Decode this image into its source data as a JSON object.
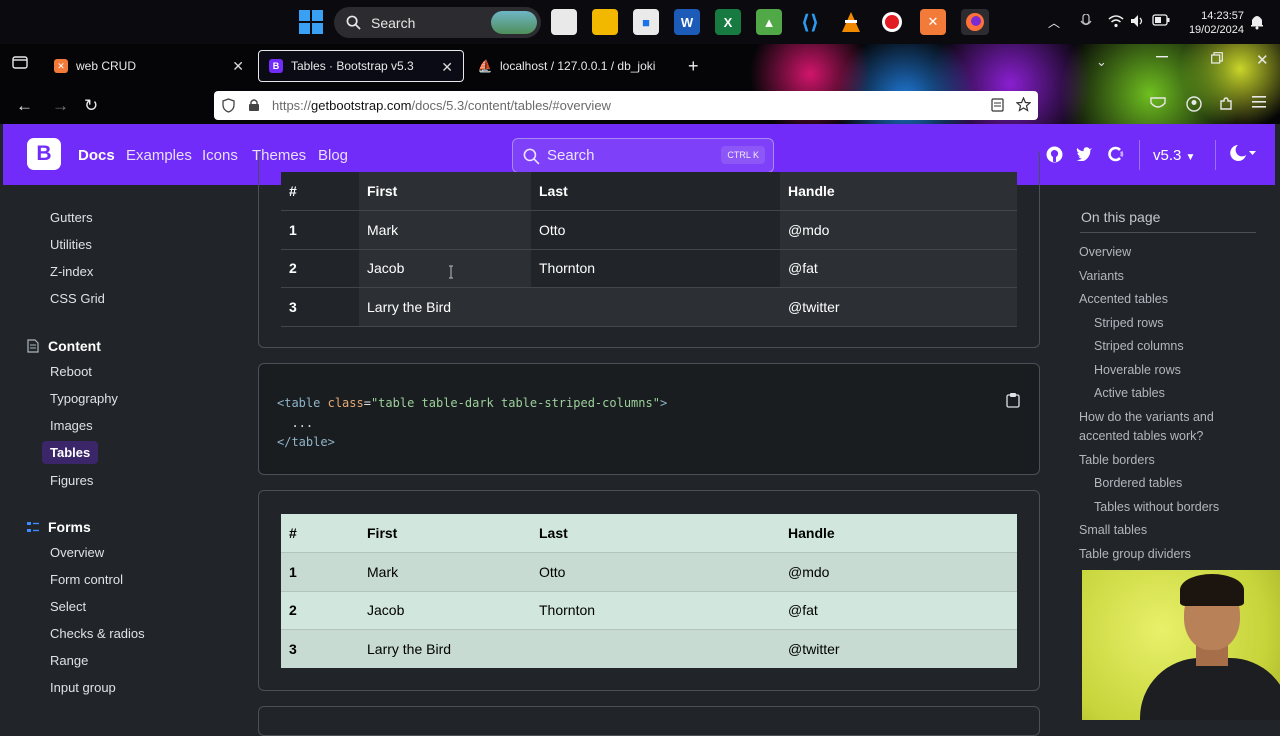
{
  "taskbar": {
    "search_label": "Search",
    "clock_time": "14:23:57",
    "clock_date": "19/02/2024"
  },
  "browser": {
    "tabs": [
      {
        "label": "web CRUD",
        "favicon": "xampp-icon"
      },
      {
        "label": "Tables · Bootstrap v5.3",
        "favicon": "bootstrap-icon"
      },
      {
        "label": "localhost / 127.0.0.1 / db_joki",
        "favicon": "phpmyadmin-icon"
      }
    ],
    "url_proto": "https://",
    "url_host": "getbootstrap.com",
    "url_path": "/docs/5.3/content/tables/#overview"
  },
  "bsnav": {
    "logo": "B",
    "links": [
      "Docs",
      "Examples",
      "Icons",
      "Themes",
      "Blog"
    ],
    "search_placeholder": "Search",
    "search_kbd": "CTRL K",
    "version": "v5.3"
  },
  "sidebar": {
    "items_top": [
      "Gutters",
      "Utilities",
      "Z-index",
      "CSS Grid"
    ],
    "content_head": "Content",
    "content_items": [
      "Reboot",
      "Typography",
      "Images",
      "Tables",
      "Figures"
    ],
    "forms_head": "Forms",
    "forms_items": [
      "Overview",
      "Form control",
      "Select",
      "Checks & radios",
      "Range",
      "Input group"
    ]
  },
  "table1": {
    "headers": [
      "#",
      "First",
      "Last",
      "Handle"
    ],
    "rows": [
      [
        "1",
        "Mark",
        "Otto",
        "@mdo"
      ],
      [
        "2",
        "Jacob",
        "Thornton",
        "@fat"
      ],
      [
        "3",
        "Larry the Bird",
        "",
        "@twitter"
      ]
    ]
  },
  "code": {
    "lt": "<",
    "tag_open": "table",
    "attr": "class",
    "eq": "=",
    "value": "\"table table-dark table-striped-columns\"",
    "gt": ">",
    "dots": "...",
    "close": "</table>"
  },
  "table2": {
    "headers": [
      "#",
      "First",
      "Last",
      "Handle"
    ],
    "rows": [
      [
        "1",
        "Mark",
        "Otto",
        "@mdo"
      ],
      [
        "2",
        "Jacob",
        "Thornton",
        "@fat"
      ],
      [
        "3",
        "Larry the Bird",
        "",
        "@twitter"
      ]
    ]
  },
  "toc": {
    "title": "On this page",
    "items": [
      {
        "label": "Overview",
        "indent": false
      },
      {
        "label": "Variants",
        "indent": false
      },
      {
        "label": "Accented tables",
        "indent": false
      },
      {
        "label": "Striped rows",
        "indent": true
      },
      {
        "label": "Striped columns",
        "indent": true
      },
      {
        "label": "Hoverable rows",
        "indent": true
      },
      {
        "label": "Active tables",
        "indent": true
      },
      {
        "label": "How do the variants and accented tables work?",
        "indent": false
      },
      {
        "label": "Table borders",
        "indent": false
      },
      {
        "label": "Bordered tables",
        "indent": true
      },
      {
        "label": "Tables without borders",
        "indent": true
      },
      {
        "label": "Small tables",
        "indent": false
      },
      {
        "label": "Table group dividers",
        "indent": false
      }
    ]
  },
  "colors": {
    "bootstrap_purple": "#712cf9",
    "table_light_success": "#d1e7dd",
    "dark_bg": "#212529"
  }
}
